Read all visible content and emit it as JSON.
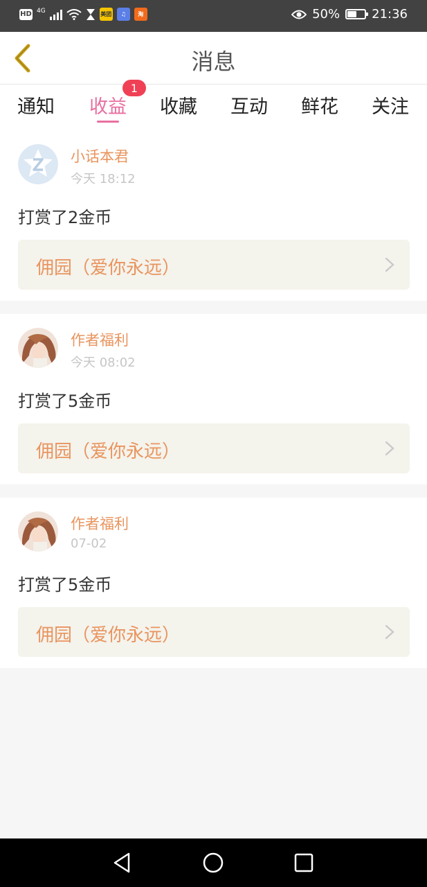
{
  "status_bar": {
    "hd": "HD",
    "network": "4G",
    "app_icons": [
      {
        "name": "meituan-icon",
        "label": "美团",
        "bg": "#f5c400",
        "fg": "#333"
      },
      {
        "name": "music-icon",
        "label": "♫",
        "bg": "#5b7fe6",
        "fg": "#fff"
      },
      {
        "name": "taobao-icon",
        "label": "淘",
        "bg": "#f26b1d",
        "fg": "#fff"
      }
    ],
    "battery": "50%",
    "battery_level": 0.5,
    "time": "21:36"
  },
  "header": {
    "title": "消息",
    "back_icon": "chevron-left-icon",
    "back_color": "#c9a21c"
  },
  "tabs": {
    "items": [
      {
        "label": "通知",
        "active": false
      },
      {
        "label": "收益",
        "active": true,
        "badge": "1"
      },
      {
        "label": "收藏",
        "active": false
      },
      {
        "label": "互动",
        "active": false
      },
      {
        "label": "鲜花",
        "active": false
      },
      {
        "label": "关注",
        "active": false
      }
    ],
    "active_color": "#e86fa0"
  },
  "messages": [
    {
      "user": "小话本君",
      "time": "今天 18:12",
      "text": "打赏了2金币",
      "link": "佣园（爱你永远）",
      "avatar": "default-avatar"
    },
    {
      "user": "作者福利",
      "time": "今天 08:02",
      "text": "打赏了5金币",
      "link": "佣园（爱你永远）",
      "avatar": "anime-girl-avatar"
    },
    {
      "user": "作者福利",
      "time": "07-02",
      "text": "打赏了5金币",
      "link": "佣园（爱你永远）",
      "avatar": "anime-girl-avatar"
    }
  ],
  "colors": {
    "accent": "#e86fa0",
    "name": "#e9945e",
    "badge": "#f04055"
  }
}
